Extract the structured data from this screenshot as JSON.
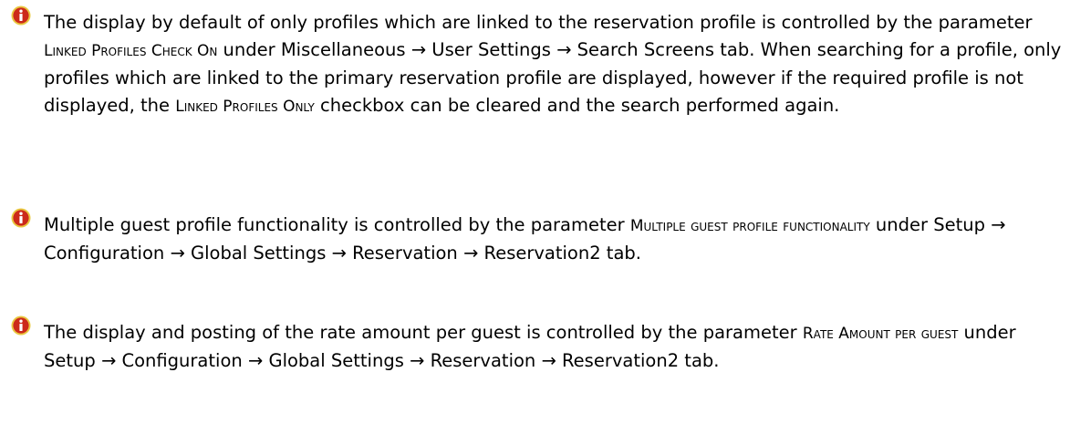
{
  "icon": {
    "name": "info-icon",
    "colors": {
      "fill": "#cc2a1a",
      "ring": "#e9c840",
      "glyph": "#ffffff"
    }
  },
  "notes": [
    {
      "parts": [
        "The display by default of only profiles which are linked to the reservation profile is controlled by the parameter ",
        "Linked Profiles Check On",
        " under Miscellaneous → User Settings → Search Screens tab. When searching for a profile, only profiles which are linked to the primary reservation profile are displayed, however if the required profile is not displayed, the ",
        "Linked Profiles Only",
        " checkbox can be cleared and the search performed again."
      ]
    },
    {
      "parts": [
        "Multiple guest profile functionality is controlled by the parameter ",
        "Multiple guest profile functionality",
        " under Setup → Configuration → Global Settings → Reservation → Reservation2 tab."
      ]
    },
    {
      "parts": [
        "The display and posting of the rate amount per guest is controlled by the parameter ",
        "Rate Amount per guest",
        " under Setup → Configuration → Global Settings → Reservation → Reservation2 tab."
      ]
    }
  ]
}
